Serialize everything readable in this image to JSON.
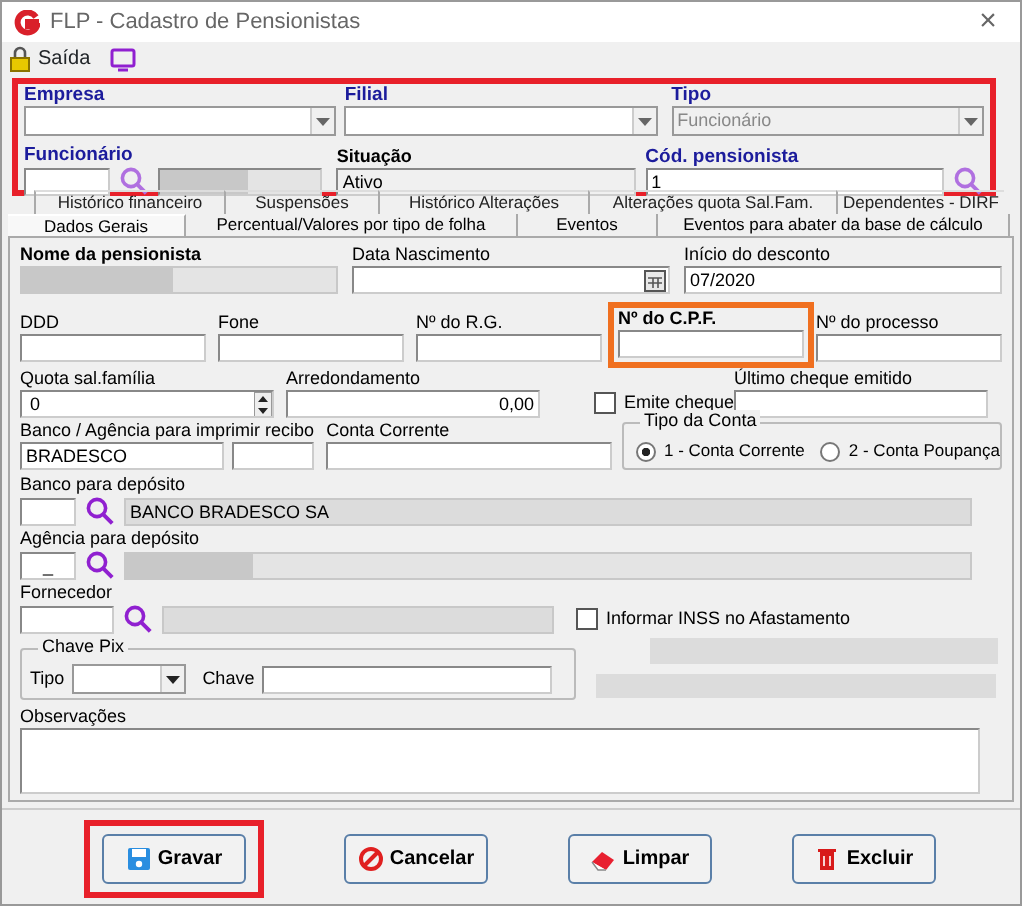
{
  "window": {
    "title": "FLP - Cadastro de Pensionistas",
    "close": "×"
  },
  "toolbar": {
    "exit_label": "Saída"
  },
  "header": {
    "empresa": {
      "label": "Empresa"
    },
    "filial": {
      "label": "Filial"
    },
    "tipo": {
      "label": "Tipo",
      "value": "Funcionário",
      "disabled": true
    },
    "funcionario": {
      "label": "Funcionário"
    },
    "situacao": {
      "label": "Situação",
      "value": "Ativo"
    },
    "cod_pensionista": {
      "label": "Cód. pensionista",
      "value": "1"
    }
  },
  "tabs_back": [
    {
      "label": "Histórico financeiro"
    },
    {
      "label": "Suspensões"
    },
    {
      "label": "Histórico Alterações"
    },
    {
      "label": "Alterações quota Sal.Fam."
    },
    {
      "label": "Dependentes - DIRF"
    }
  ],
  "tabs": [
    {
      "label": "Dados Gerais",
      "selected": true
    },
    {
      "label": "Percentual/Valores por tipo de folha",
      "selected": false
    },
    {
      "label": "Eventos",
      "selected": false
    },
    {
      "label": "Eventos para abater da base de cálculo",
      "selected": false
    }
  ],
  "form": {
    "nome": {
      "label": "Nome da pensionista"
    },
    "data_nascimento": {
      "label": "Data Nascimento"
    },
    "inicio_desconto": {
      "label": "Início do desconto",
      "value": "07/2020"
    },
    "ddd": {
      "label": "DDD"
    },
    "fone": {
      "label": "Fone"
    },
    "rg": {
      "label": "Nº do R.G."
    },
    "cpf": {
      "label": "Nº do C.P.F."
    },
    "processo": {
      "label": "Nº do processo"
    },
    "quota": {
      "label": "Quota sal.família",
      "value": "0"
    },
    "arredondamento": {
      "label": "Arredondamento",
      "value": "0,00"
    },
    "emite_cheque": {
      "label": "Emite cheque",
      "checked": false
    },
    "ultimo_cheque": {
      "label": "Último cheque emitido"
    },
    "banco_recibo": {
      "label": "Banco / Agência para imprimir recibo",
      "value": "BRADESCO"
    },
    "conta_corrente": {
      "label": "Conta Corrente"
    },
    "tipo_conta": {
      "label": "Tipo da Conta",
      "options": [
        {
          "label": "1 - Conta Corrente",
          "selected": true
        },
        {
          "label": "2 - Conta Poupança",
          "selected": false
        }
      ]
    },
    "banco_deposito": {
      "label": "Banco para depósito",
      "name": "BANCO BRADESCO SA"
    },
    "agencia_deposito": {
      "label": "Agência para depósito",
      "value": "_"
    },
    "fornecedor": {
      "label": "Fornecedor"
    },
    "informar_inss": {
      "label": "Informar INSS no Afastamento",
      "checked": false
    },
    "chave_pix": {
      "label": "Chave Pix",
      "tipo_label": "Tipo",
      "chave_label": "Chave"
    },
    "observacoes": {
      "label": "Observações"
    }
  },
  "buttons": [
    {
      "label": "Gravar",
      "kind": "save"
    },
    {
      "label": "Cancelar",
      "kind": "cancel"
    },
    {
      "label": "Limpar",
      "kind": "clear"
    },
    {
      "label": "Excluir",
      "kind": "delete"
    }
  ]
}
